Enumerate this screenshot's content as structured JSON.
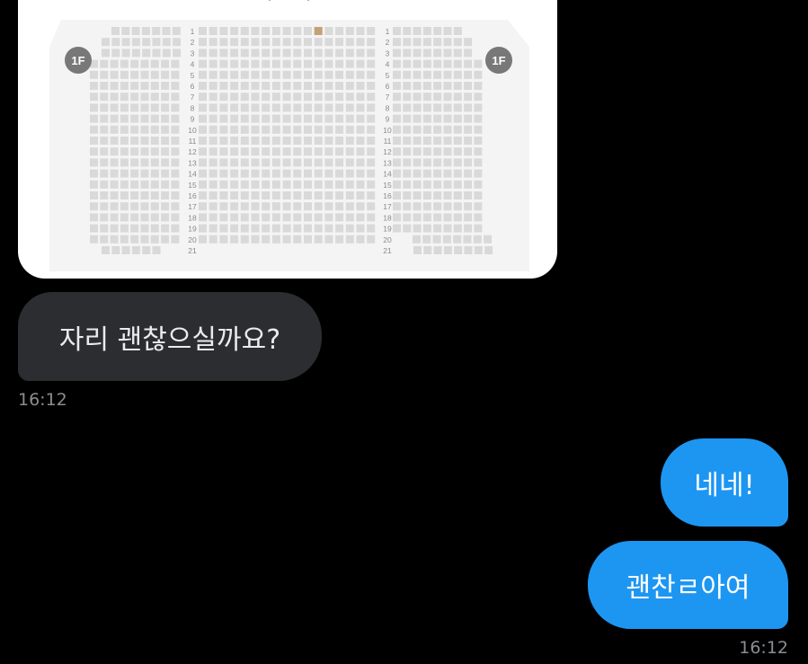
{
  "seat_map": {
    "floor_label_left": "1F",
    "floor_label_right": "1F",
    "row_numbers": [
      "1",
      "2",
      "3",
      "4",
      "5",
      "6",
      "7",
      "8",
      "9",
      "10",
      "11",
      "12",
      "13",
      "14",
      "15",
      "16",
      "17",
      "18",
      "19",
      "20",
      "21"
    ],
    "selected_seat": {
      "row": "1",
      "block": "center",
      "seat_index": 11
    },
    "colors": {
      "seat": "#d9d9d9",
      "selected": "#c7a077",
      "card": "#ffffff",
      "stage_area": "#f4f4f4"
    }
  },
  "messages": [
    {
      "direction": "incoming",
      "text": "자리 괜찮으실까요?",
      "time": "16:12"
    },
    {
      "direction": "outgoing",
      "text": "네네!"
    },
    {
      "direction": "outgoing",
      "text": "괜찬ㄹ아여",
      "time": "16:12"
    }
  ],
  "colors": {
    "background": "#000000",
    "incoming_bubble": "#2b2d30",
    "outgoing_bubble": "#1d96f2"
  }
}
